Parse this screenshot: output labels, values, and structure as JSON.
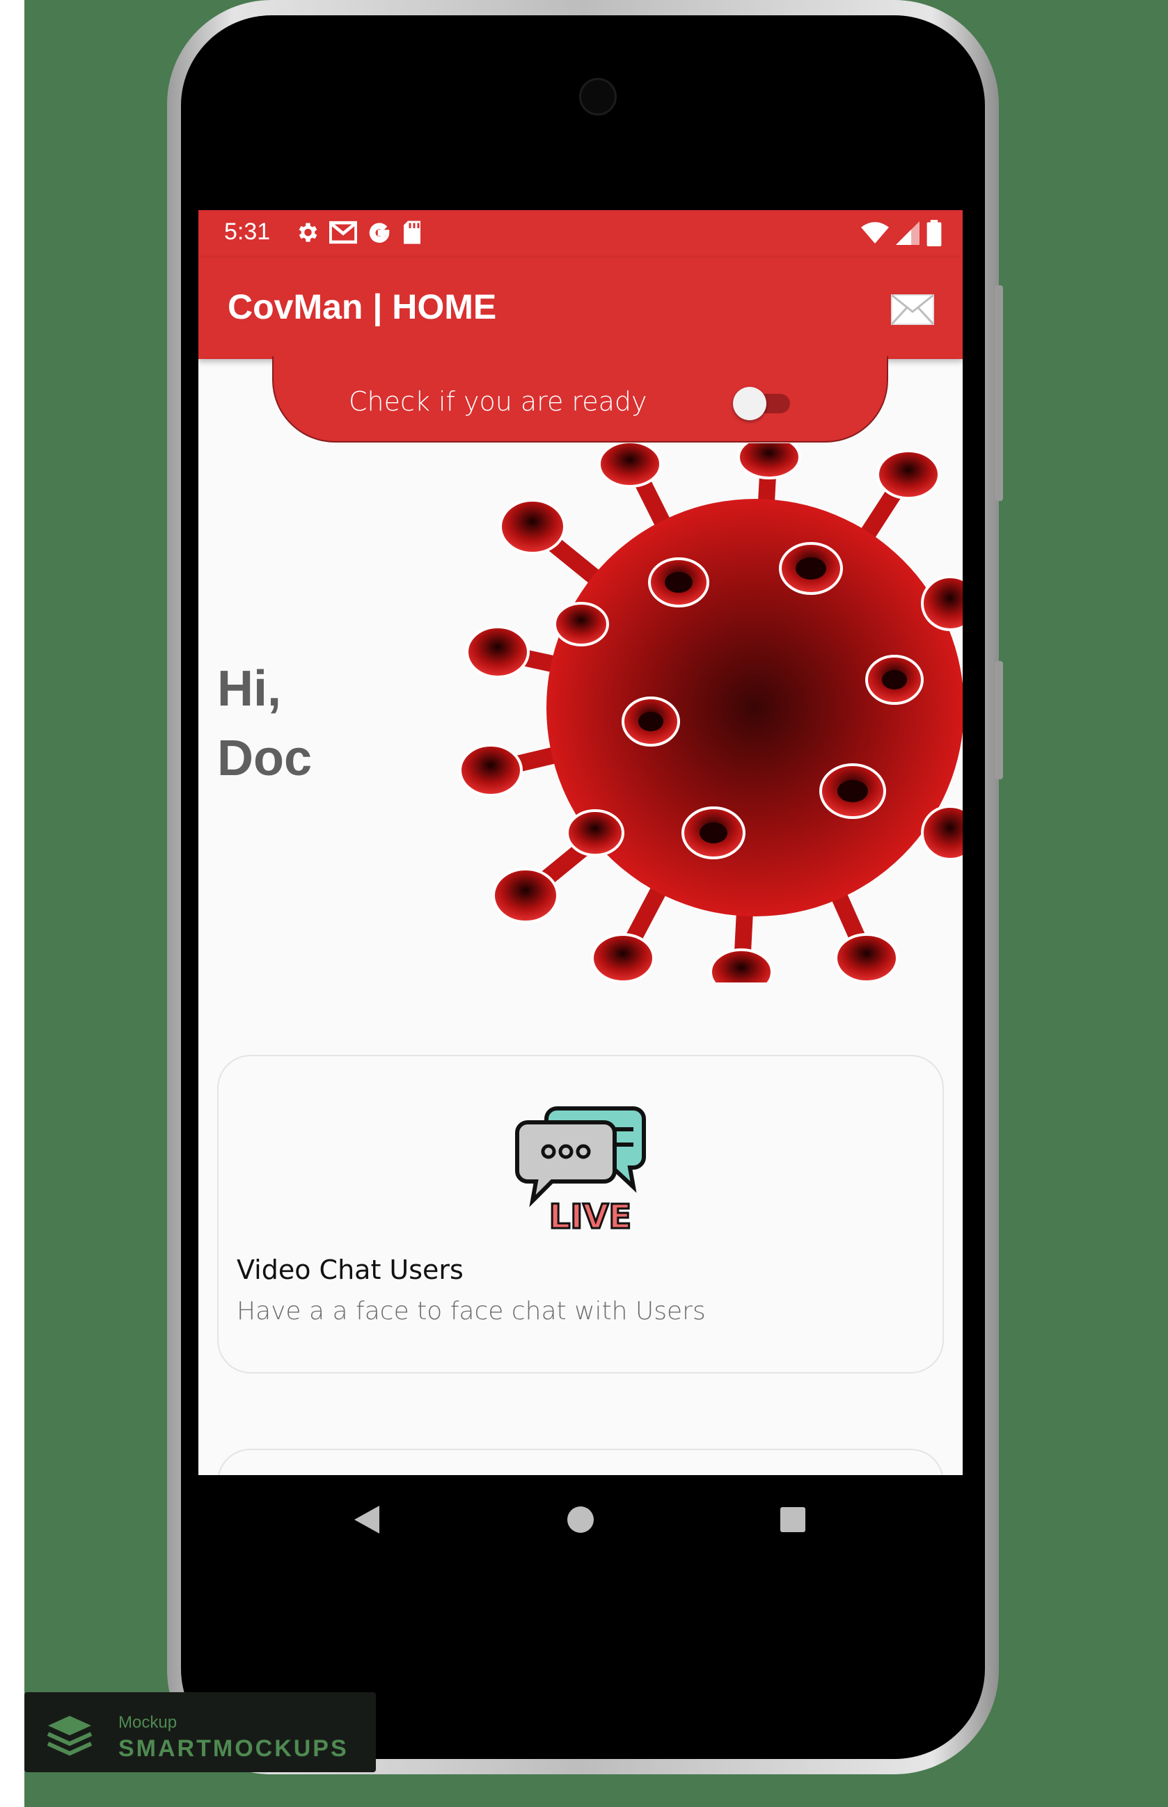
{
  "status_bar": {
    "time": "5:31",
    "left_icons": [
      "gear-icon",
      "gmail-icon",
      "google-icon",
      "sd-card-icon"
    ],
    "right_icons": [
      "wifi-icon",
      "signal-icon",
      "battery-icon"
    ]
  },
  "app_bar": {
    "title": "CovMan | HOME",
    "action_icon": "mail-icon"
  },
  "ready_toggle": {
    "label": "Check if you are ready",
    "checked": false
  },
  "greeting": {
    "line1": "Hi,",
    "line2": "Doc"
  },
  "cards": [
    {
      "icon": "live-chat-icon",
      "icon_text": "LIVE",
      "title": "Video Chat Users",
      "description": "Have a a face to face chat with Users"
    }
  ],
  "nav_bar": {
    "buttons": [
      "back-icon",
      "home-icon",
      "recents-icon"
    ]
  },
  "watermark": {
    "small": "Mockup",
    "big": "SMARTMOCKUPS"
  },
  "colors": {
    "primary": "#d93030",
    "background": "#4a7a50",
    "screen_bg": "#fafafa"
  }
}
